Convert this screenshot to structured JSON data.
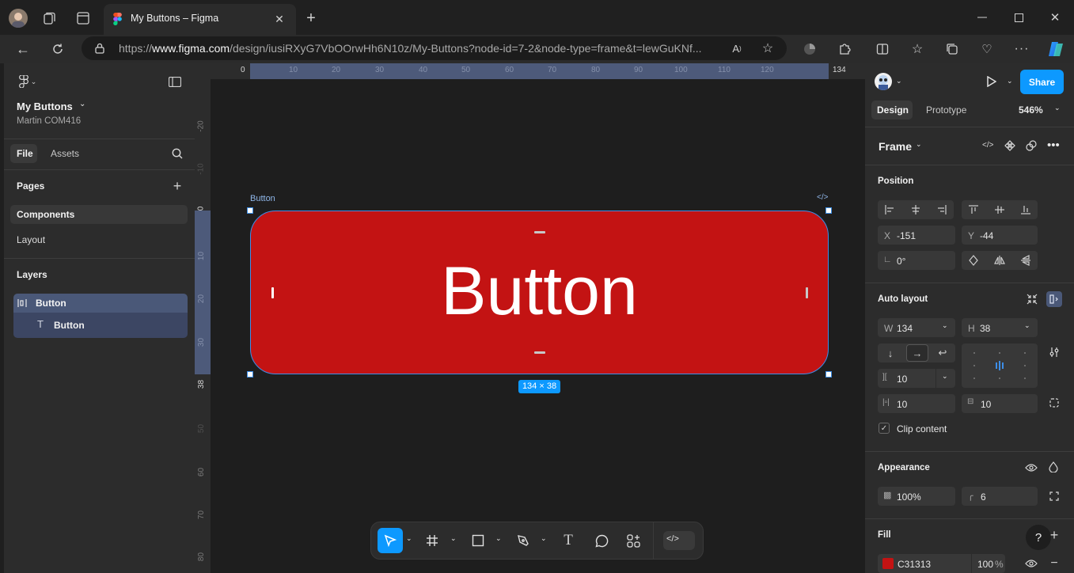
{
  "browser": {
    "tab_title": "My Buttons – Figma",
    "url_prefix": "https://",
    "url_host": "www.figma.com",
    "url_path": "/design/iusiRXyG7VbOOrwHh6N10z/My-Buttons?node-id=7-2&node-type=frame&t=lewGuKNf..."
  },
  "file": {
    "name": "My Buttons",
    "team": "Martin COM416",
    "tabs": [
      "File",
      "Assets"
    ]
  },
  "pages": {
    "title": "Pages",
    "items": [
      "Components",
      "Layout"
    ]
  },
  "layers": {
    "title": "Layers",
    "items": [
      {
        "name": "Button",
        "type": "frame"
      },
      {
        "name": "Button",
        "type": "text"
      }
    ]
  },
  "canvas": {
    "frame_label": "Button",
    "button_text": "Button",
    "button_color": "#C31313",
    "dimensions": "134 × 38",
    "ruler_top": [
      "0",
      "10",
      "20",
      "30",
      "40",
      "50",
      "60",
      "70",
      "80",
      "90",
      "100",
      "110",
      "120",
      "134"
    ],
    "ruler_left": [
      "-20",
      "-10",
      "0",
      "10",
      "20",
      "30",
      "38",
      "50",
      "60",
      "70",
      "80"
    ]
  },
  "right": {
    "share_label": "Share",
    "tabs": [
      "Design",
      "Prototype"
    ],
    "zoom": "546%",
    "frame_label": "Frame",
    "position_title": "Position",
    "x_label": "X",
    "x_value": "-151",
    "y_label": "Y",
    "y_value": "-44",
    "rotation": "0°",
    "autolayout_title": "Auto layout",
    "w_label": "W",
    "w_value": "134",
    "h_label": "H",
    "h_value": "38",
    "gap": "10",
    "pad_h": "10",
    "pad_v": "10",
    "clip_label": "Clip content",
    "appearance_title": "Appearance",
    "opacity": "100%",
    "radius": "6",
    "fill_title": "Fill",
    "fill_hex": "C31313",
    "fill_opacity": "100",
    "fill_unit": "%"
  }
}
